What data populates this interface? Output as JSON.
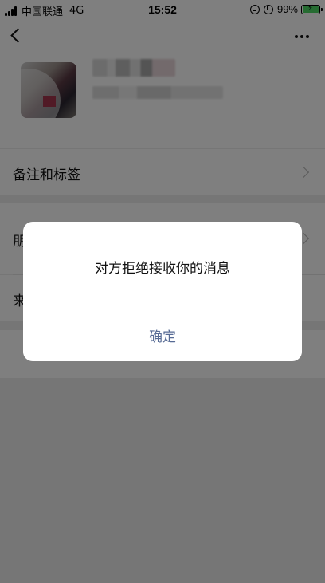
{
  "status_bar": {
    "carrier": "中国联通",
    "network": "4G",
    "time": "15:52",
    "battery": "99%"
  },
  "nav": {
    "back_icon": "chevron-left-icon",
    "more_icon": "ellipsis-icon"
  },
  "rows": [
    {
      "label": "备注和标签"
    },
    {
      "label": "朋"
    },
    {
      "label": "来"
    }
  ],
  "dialog": {
    "message": "对方拒绝接收你的消息",
    "confirm": "确定"
  },
  "colors": {
    "link": "#576b95",
    "overlay": "rgba(0,0,0,0.5)",
    "battery_fill": "#4cd964"
  }
}
